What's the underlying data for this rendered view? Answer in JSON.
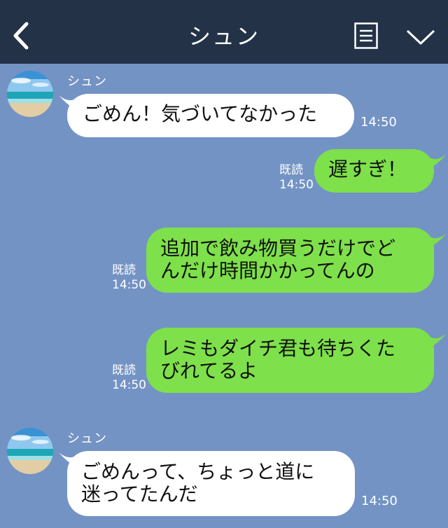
{
  "header": {
    "title": "シュン",
    "back_icon": "chevron-left-icon",
    "menu_icon": "menu-list-icon",
    "expand_icon": "chevron-down-icon",
    "bar_color": "#233247"
  },
  "chat": {
    "background": "#7393c4",
    "incoming_color": "#ffffff",
    "outgoing_color": "#7ee04a",
    "messages": [
      {
        "sender": "シュン",
        "direction": "in",
        "lines": [
          "ごめん！気づいてなかった"
        ],
        "time": "14:50"
      },
      {
        "direction": "out",
        "read": "既読",
        "lines": [
          "遅すぎ！"
        ],
        "time": "14:50"
      },
      {
        "direction": "out",
        "read": "既読",
        "lines": [
          "追加で飲み物買うだけでど",
          "んだけ時間かかってんの"
        ],
        "time": "14:50"
      },
      {
        "direction": "out",
        "read": "既読",
        "lines": [
          "レミもダイチ君も待ちくた",
          "びれてるよ"
        ],
        "time": "14:50"
      },
      {
        "sender": "シュン",
        "direction": "in",
        "lines": [
          "ごめんって、ちょっと道に",
          "迷ってたんだ"
        ],
        "time": "14:50"
      }
    ]
  }
}
